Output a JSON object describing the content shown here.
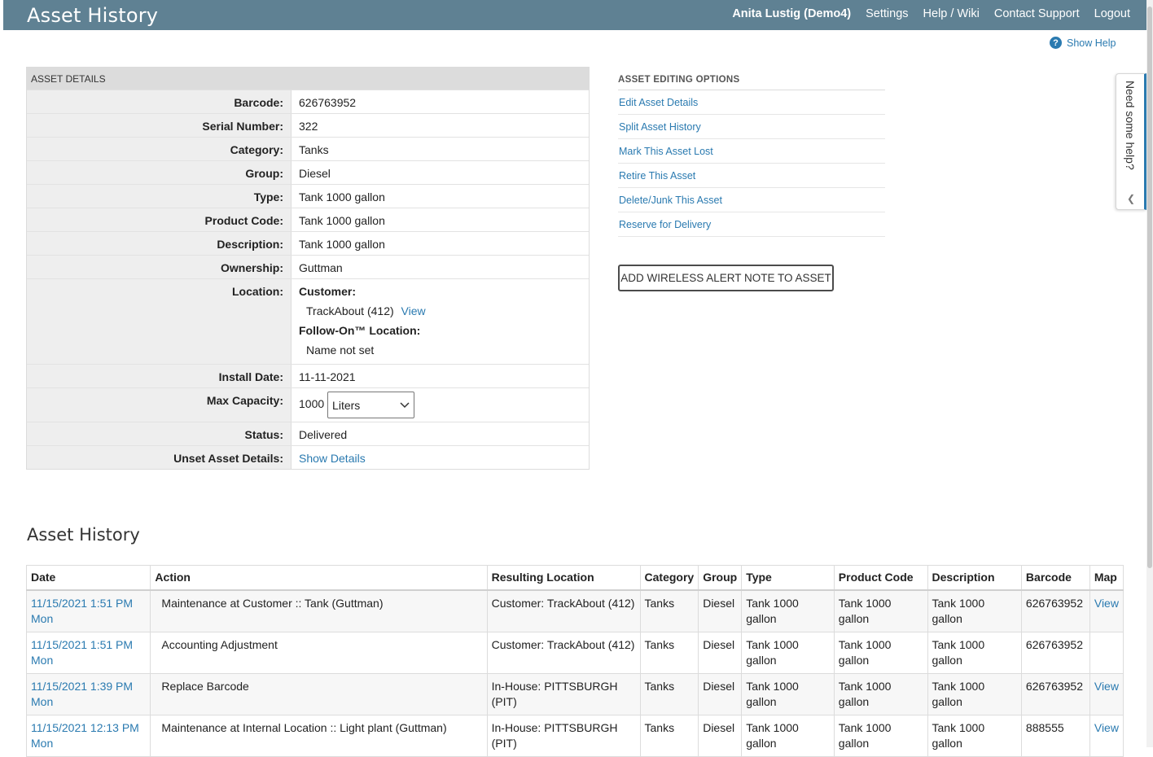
{
  "header": {
    "title": "Asset History",
    "nav": [
      "Anita Lustig (Demo4)",
      "Settings",
      "Help / Wiki",
      "Contact Support",
      "Logout"
    ]
  },
  "show_help": "Show Help",
  "details": {
    "title": "ASSET DETAILS",
    "barcode_label": "Barcode:",
    "barcode": "626763952",
    "serial_label": "Serial Number:",
    "serial": "322",
    "category_label": "Category:",
    "category": "Tanks",
    "group_label": "Group:",
    "group": "Diesel",
    "type_label": "Type:",
    "type": "Tank 1000 gallon",
    "product_code_label": "Product Code:",
    "product_code": "Tank 1000 gallon",
    "description_label": "Description:",
    "description": "Tank 1000 gallon",
    "ownership_label": "Ownership:",
    "ownership": "Guttman",
    "location_label": "Location:",
    "location_customer_label": "Customer:",
    "location_customer": "TrackAbout (412)",
    "location_view": "View",
    "follow_on_label": "Follow-On™ Location:",
    "follow_on_value": "Name not set",
    "install_date_label": "Install Date:",
    "install_date": "11-11-2021",
    "max_capacity_label": "Max Capacity:",
    "max_capacity": "1000",
    "capacity_unit": "Liters",
    "status_label": "Status:",
    "status": "Delivered",
    "unset_label": "Unset Asset Details:",
    "unset_link": "Show Details"
  },
  "editing": {
    "title": "ASSET EDITING OPTIONS",
    "items": [
      "Edit Asset Details",
      "Split Asset History",
      "Mark This Asset Lost",
      "Retire This Asset",
      "Delete/Junk This Asset",
      "Reserve for Delivery"
    ]
  },
  "alert_button": "ADD WIRELESS ALERT NOTE TO ASSET",
  "help_tab": "Need some help?",
  "history": {
    "title": "Asset History",
    "columns": [
      "Date",
      "Action",
      "Resulting Location",
      "Category",
      "Group",
      "Type",
      "Product Code",
      "Description",
      "Barcode",
      "Map"
    ],
    "rows": [
      {
        "date": "11/15/2021 1:51 PM",
        "day": "Mon",
        "action": "Maintenance at Customer :: Tank (Guttman)",
        "location": "Customer: TrackAbout (412)",
        "category": "Tanks",
        "group": "Diesel",
        "type": "Tank 1000 gallon",
        "product_code": "Tank 1000 gallon",
        "description": "Tank 1000 gallon",
        "barcode": "626763952",
        "map": "View"
      },
      {
        "date": "11/15/2021 1:51 PM",
        "day": "Mon",
        "action": "Accounting Adjustment",
        "location": "Customer: TrackAbout (412)",
        "category": "Tanks",
        "group": "Diesel",
        "type": "Tank 1000 gallon",
        "product_code": "Tank 1000 gallon",
        "description": "Tank 1000 gallon",
        "barcode": "626763952",
        "map": ""
      },
      {
        "date": "11/15/2021 1:39 PM",
        "day": "Mon",
        "action": "Replace Barcode",
        "location": "In-House: PITTSBURGH (PIT)",
        "category": "Tanks",
        "group": "Diesel",
        "type": "Tank 1000 gallon",
        "product_code": "Tank 1000 gallon",
        "description": "Tank 1000 gallon",
        "barcode": "626763952",
        "map": "View"
      },
      {
        "date": "11/15/2021 12:13 PM",
        "day": "Mon",
        "action": "Maintenance at Internal Location :: Light plant (Guttman)",
        "location": "In-House: PITTSBURGH (PIT)",
        "category": "Tanks",
        "group": "Diesel",
        "type": "Tank 1000 gallon",
        "product_code": "Tank 1000 gallon",
        "description": "Tank 1000 gallon",
        "barcode": "888555",
        "map": "View"
      }
    ]
  }
}
